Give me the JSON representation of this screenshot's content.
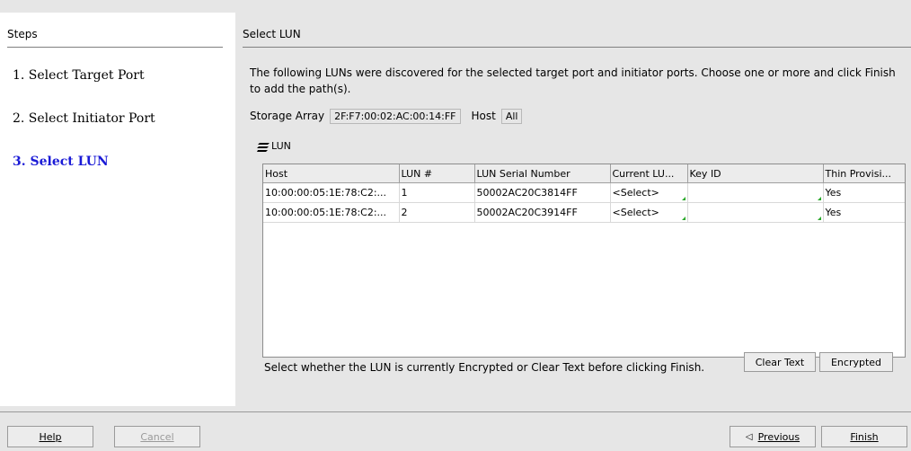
{
  "steps": {
    "title": "Steps",
    "items": [
      {
        "label": "1. Select Target Port"
      },
      {
        "label": "2. Select Initiator Port"
      },
      {
        "label": "3. Select LUN"
      }
    ]
  },
  "main": {
    "title": "Select LUN",
    "description": "The following LUNs were discovered for the selected target port and initiator ports. Choose one or more and click Finish to add the path(s).",
    "storage_array_label": "Storage Array",
    "storage_array_value": "2F:F7:00:02:AC:00:14:FF",
    "host_label": "Host",
    "host_value": "All",
    "lun_heading": "LUN",
    "table": {
      "columns": [
        "Host",
        "LUN #",
        "LUN Serial Number",
        "Current LU...",
        "Key ID",
        "Thin Provisi..."
      ],
      "rows": [
        [
          "10:00:00:05:1E:78:C2:...",
          "1",
          "50002AC20C3814FF",
          "<Select>",
          "",
          "Yes"
        ],
        [
          "10:00:00:05:1E:78:C2:...",
          "2",
          "50002AC20C3914FF",
          "<Select>",
          "",
          "Yes"
        ]
      ]
    },
    "bottom_note": "Select whether the LUN is currently Encrypted or Clear Text before clicking Finish.",
    "clear_text_label": "Clear Text",
    "encrypted_label": "Encrypted"
  },
  "footer": {
    "help_label": "Help",
    "cancel_label": "Cancel",
    "previous_label": "Previous",
    "finish_label": "Finish"
  },
  "colors": {
    "active_step": "#1a1ad6",
    "selection_marker": "#2aa82a"
  }
}
